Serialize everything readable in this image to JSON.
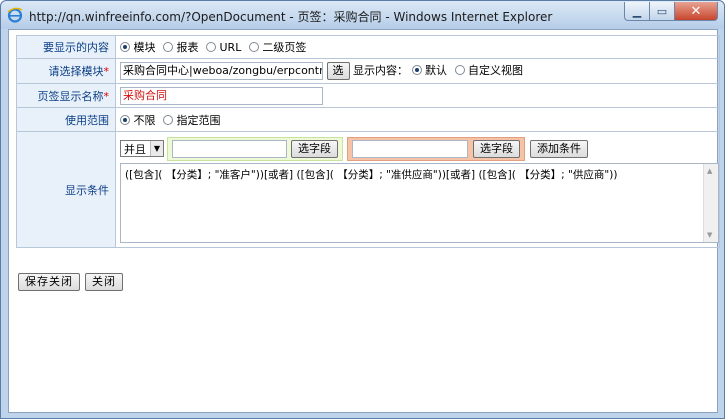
{
  "window": {
    "title": "http://qn.winfreeinfo.com/?OpenDocument - 页签：采购合同 - Windows Internet Explorer",
    "min_glyph": "▁",
    "max_glyph": "▭",
    "close_glyph": "✕"
  },
  "form": {
    "content_type": {
      "label": "要显示的内容",
      "options": [
        "模块",
        "报表",
        "URL",
        "二级页签"
      ],
      "selected": "模块"
    },
    "module": {
      "label": "请选择模块",
      "required_mark": "*",
      "value": "采购合同中心|weboa/zongbu/erpcontractbo",
      "select_button": "选",
      "display_label": "显示内容：",
      "display_options": [
        "默认",
        "自定义视图"
      ],
      "display_selected": "默认"
    },
    "tab_name": {
      "label": "页签显示名称",
      "required_mark": "*",
      "value": "采购合同",
      "value_color": "#d01010"
    },
    "scope": {
      "label": "使用范围",
      "options": [
        "不限",
        "指定范围"
      ],
      "selected": "不限"
    },
    "condition": {
      "label": "显示条件",
      "logic_select": "并且",
      "select_field_button_1": "选字段",
      "select_field_button_2": "选字段",
      "add_condition_button": "添加条件",
      "expression": "([包含]( 【分类】; \"准客户\"))[或者] ([包含]( 【分类】; \"准供应商\"))[或者] ([包含]( 【分类】; \"供应商\"))"
    }
  },
  "actions": {
    "save_close": "保存关闭",
    "close": "关闭"
  },
  "colors": {
    "label_text": "#0c3f86",
    "label_bg": "#e8f0fa",
    "required": "#d00000",
    "green_zone": "#eefad6",
    "orange_zone": "#f7c3a7"
  }
}
